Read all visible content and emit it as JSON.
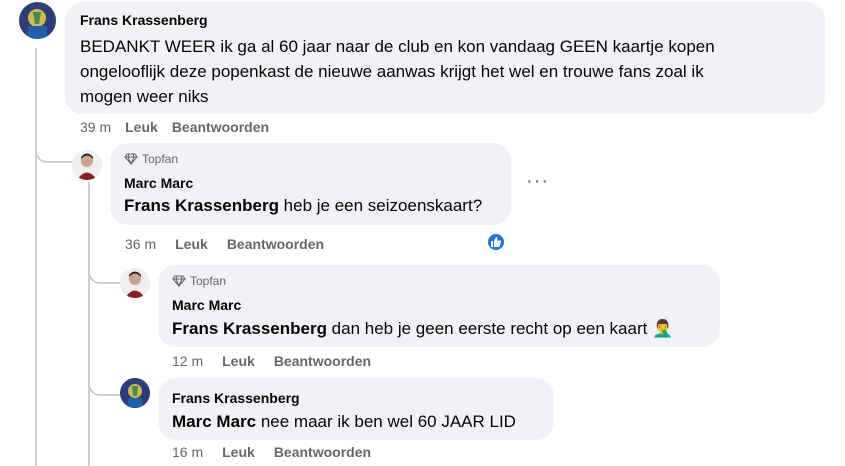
{
  "comments": [
    {
      "author": "Frans Krassenberg",
      "lines": [
        "BEDANKT WEER ik ga al 60 jaar naar de club en kon vandaag GEEN kaartje kopen",
        "ongelooflijk deze popenkast de nieuwe aanwas krijgt het wel en trouwe fans zoal ik",
        "mogen weer niks"
      ],
      "time": "39 m",
      "like": "Leuk",
      "reply": "Beantwoorden"
    },
    {
      "badge": "Topfan",
      "author": "Marc Marc",
      "mention": "Frans Krassenberg",
      "text": " heb je een seizoenskaart?",
      "time": "36 m",
      "like": "Leuk",
      "reply": "Beantwoorden",
      "reaction_icon": "thumbs-up-icon"
    },
    {
      "badge": "Topfan",
      "author": "Marc Marc",
      "mention": "Frans Krassenberg",
      "text": " dan heb je geen eerste recht op een kaart ",
      "emoji": "🤦‍♂️",
      "time": "12 m",
      "like": "Leuk",
      "reply": "Beantwoorden"
    },
    {
      "author": "Frans Krassenberg",
      "mention": "Marc Marc",
      "text": " nee maar ik ben wel 60 JAAR LID",
      "time": "16 m",
      "like": "Leuk",
      "reply": "Beantwoorden"
    }
  ],
  "colors": {
    "bubble": "#f0f2f5",
    "meta": "#65676b",
    "reaction": "#1b74e4",
    "thread_line": "#ccd0d5"
  }
}
